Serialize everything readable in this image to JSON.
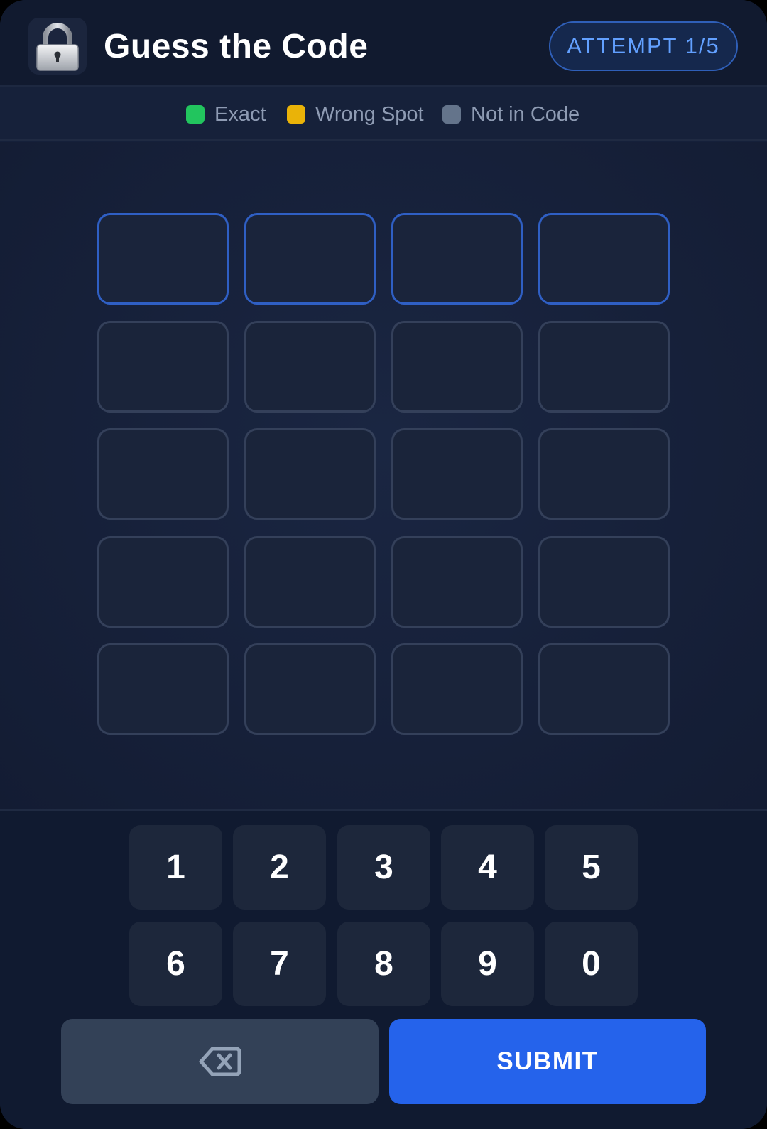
{
  "header": {
    "icon": "lock-icon",
    "title": "Guess the Code",
    "attempt_label": "ATTEMPT 1/5"
  },
  "legend": [
    {
      "label": "Exact",
      "color": "#22c55e"
    },
    {
      "label": "Wrong Spot",
      "color": "#eab308"
    },
    {
      "label": "Not in Code",
      "color": "#64748b"
    }
  ],
  "board": {
    "rows": 5,
    "columns": 4,
    "active_row": 1,
    "cells": [
      [
        "",
        "",
        "",
        ""
      ],
      [
        "",
        "",
        "",
        ""
      ],
      [
        "",
        "",
        "",
        ""
      ],
      [
        "",
        "",
        "",
        ""
      ],
      [
        "",
        "",
        "",
        ""
      ]
    ]
  },
  "keypad": {
    "keys": [
      "1",
      "2",
      "3",
      "4",
      "5",
      "6",
      "7",
      "8",
      "9",
      "0"
    ],
    "backspace_icon": "backspace-icon",
    "submit_label": "SUBMIT"
  },
  "colors": {
    "accent": "#2563eb",
    "active_cell_border": "#2f5fc4",
    "background": "#15203a"
  }
}
